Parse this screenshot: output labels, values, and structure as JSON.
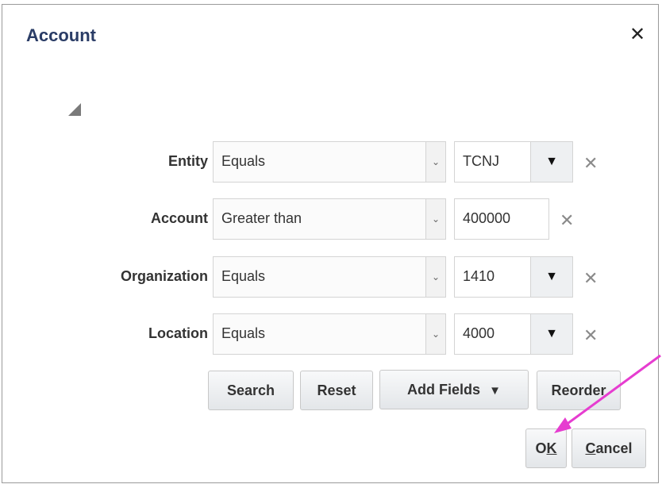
{
  "dialog": {
    "title": "Account",
    "close_label": "✕"
  },
  "rows": [
    {
      "label": "Entity",
      "operator": "Equals",
      "value": "TCNJ",
      "has_dropdown": true
    },
    {
      "label": "Account",
      "operator": "Greater than",
      "value": "400000",
      "has_dropdown": false
    },
    {
      "label": "Organization",
      "operator": "Equals",
      "value": "1410",
      "has_dropdown": true
    },
    {
      "label": "Location",
      "operator": "Equals",
      "value": "4000",
      "has_dropdown": true
    }
  ],
  "icons": {
    "select_arrow": "⌄",
    "dropdown": "▼",
    "remove": "✕"
  },
  "buttons": {
    "search": "Search",
    "reset": "Reset",
    "add_fields": "Add Fields",
    "add_fields_arrow": "▼",
    "reorder": "Reorder",
    "ok_pre": "O",
    "ok_u": "K",
    "cancel_u": "C",
    "cancel_post": "ancel"
  },
  "annotation": {
    "arrow_color": "#e63dd0"
  }
}
